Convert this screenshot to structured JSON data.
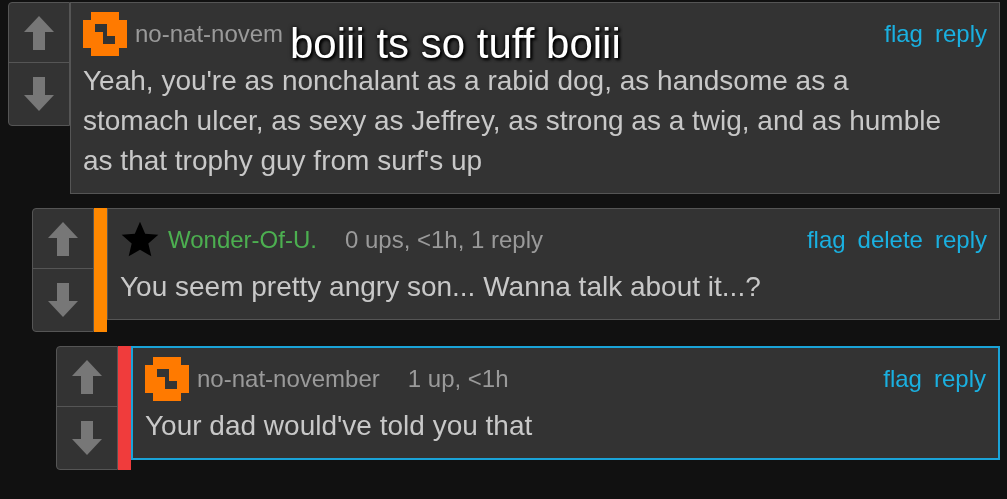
{
  "caption": "boiii ts so tuff boiii",
  "comments": [
    {
      "kind": "pixel",
      "username": {
        "text": "no-nat-novem",
        "color": "#9a9a9a"
      },
      "actions": [
        "flag",
        "reply"
      ],
      "text": "Yeah, you're as nonchalant as a rabid dog, as handsome as a stomach ulcer, as sexy as Jeffrey, as strong as a twig, and as humble as that trophy guy from surf's up",
      "highlighted": false,
      "children": [
        {
          "kind": "star",
          "username": {
            "text": "Wonder-Of-U.",
            "color": "#4caf50"
          },
          "meta": "0 ups, <1h, 1 reply",
          "actions": [
            "flag",
            "delete",
            "reply"
          ],
          "text": "You seem pretty angry son... Wanna talk about it...?",
          "color": "#ff8800",
          "highlighted": false,
          "children": [
            {
              "kind": "pixel",
              "username": {
                "text": "no-nat-november",
                "color": "#9a9a9a"
              },
              "meta": "1 up, <1h",
              "actions": [
                "flag",
                "reply"
              ],
              "text": "Your dad would've told you that",
              "color": "#f03c3c",
              "highlighted": true
            }
          ]
        }
      ]
    }
  ]
}
